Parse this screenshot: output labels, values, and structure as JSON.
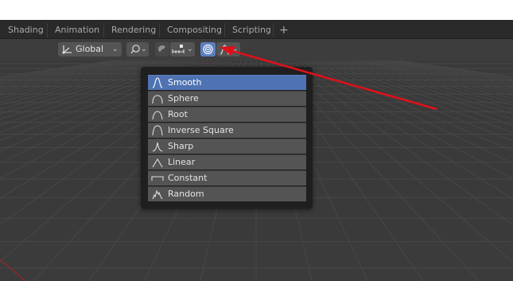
{
  "workspace_tabs": [
    "Shading",
    "Animation",
    "Rendering",
    "Compositing",
    "Scripting"
  ],
  "add_tab_label": "+",
  "toolbar": {
    "transform_orientation": "Global"
  },
  "falloff_menu": {
    "items": [
      {
        "label": "Smooth",
        "icon": "smooth-falloff-icon",
        "selected": true
      },
      {
        "label": "Sphere",
        "icon": "sphere-falloff-icon",
        "selected": false
      },
      {
        "label": "Root",
        "icon": "root-falloff-icon",
        "selected": false
      },
      {
        "label": "Inverse Square",
        "icon": "inverse-square-falloff-icon",
        "selected": false
      },
      {
        "label": "Sharp",
        "icon": "sharp-falloff-icon",
        "selected": false
      },
      {
        "label": "Linear",
        "icon": "linear-falloff-icon",
        "selected": false
      },
      {
        "label": "Constant",
        "icon": "constant-falloff-icon",
        "selected": false
      },
      {
        "label": "Random",
        "icon": "random-falloff-icon",
        "selected": false
      }
    ]
  },
  "colors": {
    "viewport_bg": "#3a3a3a",
    "header_bg": "#2a2a2a",
    "toolbar_bg": "#3d3d3d",
    "selection_blue": "#4f73b2",
    "annotation_arrow": "#e0101a",
    "x_axis_red": "#8a2a2a"
  }
}
